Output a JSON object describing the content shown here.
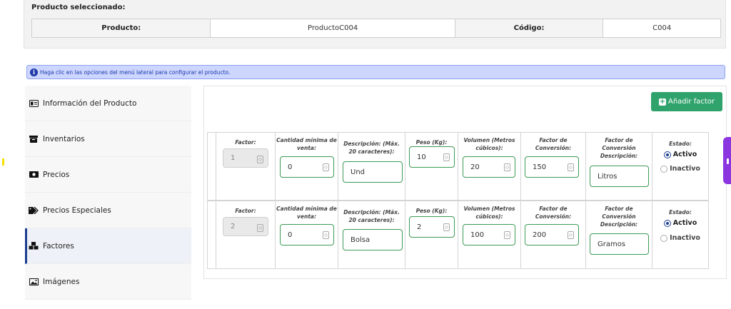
{
  "product_panel": {
    "title": "Producto seleccionado:",
    "product_label": "Producto:",
    "product_value": "ProductoC004",
    "code_label": "Código:",
    "code_value": "C004"
  },
  "info": {
    "icon": "info-icon",
    "message": "Haga clic en las opciones del menú lateral para configurar el producto."
  },
  "sidebar": {
    "items": [
      {
        "label": "Información del Producto",
        "icon": "id-card-icon"
      },
      {
        "label": "Inventarios",
        "icon": "archive-box-icon"
      },
      {
        "label": "Precios",
        "icon": "money-bill-icon"
      },
      {
        "label": "Precios Especiales",
        "icon": "tags-icon"
      },
      {
        "label": "Factores",
        "icon": "cubes-icon",
        "active": true
      },
      {
        "label": "Imágenes",
        "icon": "image-icon"
      }
    ]
  },
  "factors": {
    "add_button": "Añadir factor",
    "headers": {
      "factor": "Factor:",
      "min_qty": "Cantidad mínima de venta:",
      "description": "Descripción: (Máx. 20 caracteres):",
      "weight": "Peso (Kg):",
      "volume": "Volumen (Metros cúbicos):",
      "conversion": "Factor de Conversión:",
      "conversion_desc": "Factor de Conversión Descripción:",
      "status": "Estado:"
    },
    "status_options": {
      "active": "Activo",
      "inactive": "Inactivo"
    },
    "rows": [
      {
        "factor": "1",
        "min_qty": "0",
        "description": "Und",
        "weight": "10",
        "volume": "20",
        "conversion": "150",
        "conversion_desc": "Litros",
        "status": "active"
      },
      {
        "factor": "2",
        "min_qty": "0",
        "description": "Bolsa",
        "weight": "2",
        "volume": "100",
        "conversion": "200",
        "conversion_desc": "Gramos",
        "status": "active"
      }
    ]
  },
  "colors": {
    "primary": "#1c3d8f",
    "success": "#2fa36b",
    "input_border": "#3d9a55",
    "info_bg": "#ccd6ff",
    "accent_tab": "#8a35e0"
  }
}
